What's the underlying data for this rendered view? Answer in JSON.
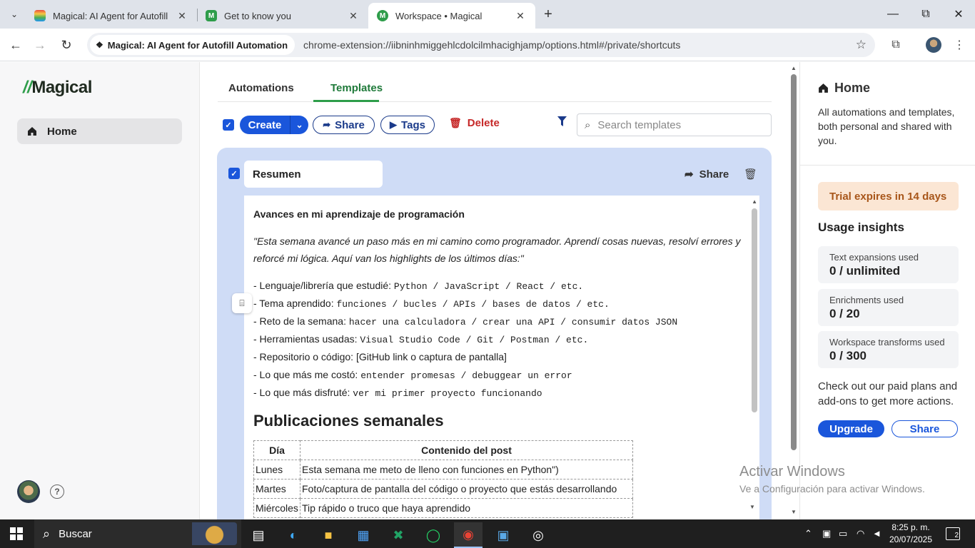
{
  "browser": {
    "tabs": [
      {
        "title": "Magical: AI Agent for Autofill A",
        "favicon": "rainbow-icon"
      },
      {
        "title": "Get to know you",
        "favicon": "magical-m-icon"
      },
      {
        "title": "Workspace • Magical",
        "favicon": "magical-m-icon",
        "active": true
      }
    ],
    "address": {
      "extension_chip": "Magical: AI Agent for Autofill Automation",
      "url": "chrome-extension://iibninhmiggehlcdolcilmhacighjamp/options.html#/private/shortcuts"
    }
  },
  "sidebar": {
    "logo": {
      "slash": "//",
      "text": "Magical"
    },
    "items": [
      {
        "label": "Home",
        "icon": "home-icon",
        "active": true
      }
    ],
    "help": "?"
  },
  "main": {
    "tabs": [
      {
        "label": "Automations"
      },
      {
        "label": "Templates",
        "active": true
      }
    ],
    "actions": {
      "create": "Create",
      "share": "Share",
      "tags": "Tags",
      "delete": "Delete",
      "search_placeholder": "Search templates"
    },
    "template": {
      "name": "Resumen",
      "share": "Share",
      "editor": {
        "heading": "Avances en mi aprendizaje de programación",
        "quote": "\"Esta semana avancé un paso más en mi camino como programador. Aprendí cosas nuevas, resolví errores y reforcé mi lógica. Aquí van los highlights de los últimos días:\"",
        "items": [
          {
            "label": "- Lenguaje/librería que estudié:",
            "value": "Python / JavaScript / React / etc."
          },
          {
            "label": "- Tema aprendido:",
            "value": "funciones / bucles / APIs / bases de datos / etc."
          },
          {
            "label": "- Reto de la semana:",
            "value": "hacer una calculadora / crear una API / consumir datos JSON"
          },
          {
            "label": "- Herramientas usadas:",
            "value": "Visual Studio Code / Git / Postman / etc."
          },
          {
            "label": "- Repositorio o código:",
            "value": "[GitHub link o captura de pantalla]"
          },
          {
            "label": "- Lo que más me costó:",
            "value": "entender promesas / debuggear un error"
          },
          {
            "label": "- Lo que más disfruté:",
            "value": "ver mi primer proyecto funcionando"
          }
        ],
        "subheading": "Publicaciones semanales",
        "table": {
          "headers": [
            "Día",
            "Contenido del post"
          ],
          "rows": [
            [
              "Lunes",
              "Esta semana me meto de lleno con funciones en Python\")"
            ],
            [
              "Martes",
              "Foto/captura de pantalla del código o proyecto que estás desarrollando"
            ],
            [
              "Miércoles",
              "Tip rápido o truco que haya aprendido"
            ]
          ]
        }
      }
    }
  },
  "right_panel": {
    "title": "Home",
    "description": "All automations and templates, both personal and shared with you.",
    "trial": "Trial expires in 14 days",
    "usage_title": "Usage insights",
    "usage": [
      {
        "label": "Text expansions used",
        "value": "0 / unlimited"
      },
      {
        "label": "Enrichments used",
        "value": "0 / 20"
      },
      {
        "label": "Workspace transforms used",
        "value": "0 / 300"
      }
    ],
    "plans_text": "Check out our paid plans and add-ons to get more actions.",
    "upgrade": "Upgrade",
    "share": "Share"
  },
  "watermark": {
    "line1": "Activar Windows",
    "line2": "Ve a Configuración para activar Windows."
  },
  "taskbar": {
    "search": "Buscar",
    "time": "8:25 p. m.",
    "date": "20/07/2025",
    "notifications": "2",
    "apps": [
      "task-view-icon",
      "edge-icon",
      "file-explorer-icon",
      "store-icon",
      "excel-icon",
      "whatsapp-icon",
      "chrome-icon",
      "remote-desktop-icon",
      "recorder-icon"
    ]
  },
  "colors": {
    "accent": "#1a56db",
    "brand_green": "#2e9d4a",
    "card_bg": "#cfdcf6",
    "delete": "#c62828",
    "trial_bg": "#fbe6d4"
  }
}
